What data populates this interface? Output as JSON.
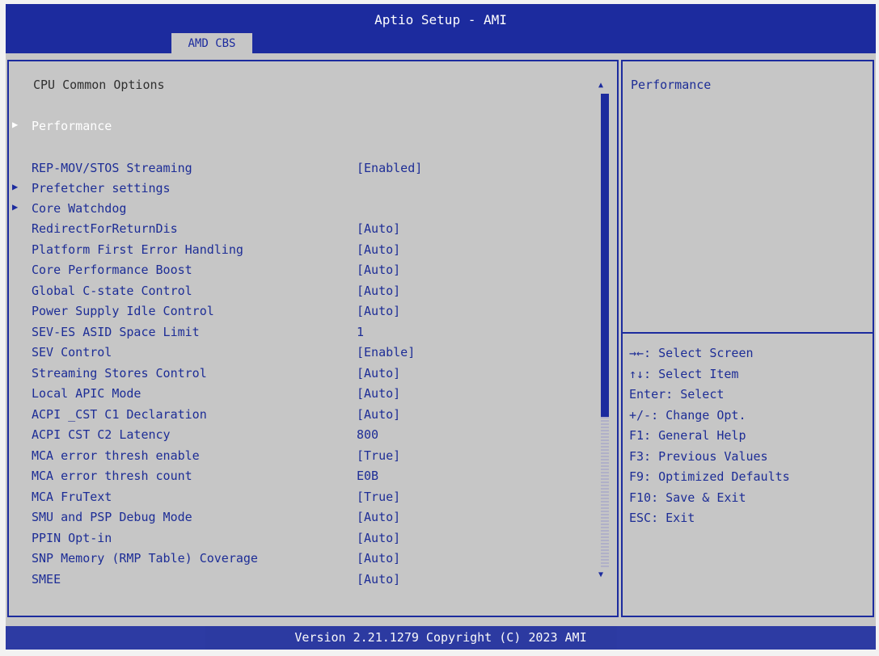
{
  "header": {
    "title": "Aptio Setup - AMI",
    "tab_label": "AMD CBS"
  },
  "main": {
    "section_title": "CPU Common Options",
    "selected_item": "Performance",
    "items": [
      {
        "label": "Performance",
        "value": "",
        "submenu": true,
        "selected": true
      },
      {
        "label": "REP-MOV/STOS Streaming",
        "value": "[Enabled]",
        "submenu": false
      },
      {
        "label": "Prefetcher settings",
        "value": "",
        "submenu": true
      },
      {
        "label": "Core Watchdog",
        "value": "",
        "submenu": true
      },
      {
        "label": "RedirectForReturnDis",
        "value": "[Auto]",
        "submenu": false
      },
      {
        "label": "Platform First Error Handling",
        "value": "[Auto]",
        "submenu": false
      },
      {
        "label": "Core Performance Boost",
        "value": "[Auto]",
        "submenu": false
      },
      {
        "label": "Global C-state Control",
        "value": "[Auto]",
        "submenu": false
      },
      {
        "label": "Power Supply Idle Control",
        "value": "[Auto]",
        "submenu": false
      },
      {
        "label": "SEV-ES ASID Space Limit",
        "value": "1",
        "submenu": false
      },
      {
        "label": "SEV Control",
        "value": "[Enable]",
        "submenu": false
      },
      {
        "label": "Streaming Stores Control",
        "value": "[Auto]",
        "submenu": false
      },
      {
        "label": "Local APIC Mode",
        "value": "[Auto]",
        "submenu": false
      },
      {
        "label": "ACPI _CST C1 Declaration",
        "value": "[Auto]",
        "submenu": false
      },
      {
        "label": "ACPI CST C2 Latency",
        "value": "800",
        "submenu": false
      },
      {
        "label": "MCA error thresh enable",
        "value": "[True]",
        "submenu": false
      },
      {
        "label": "MCA error thresh count",
        "value": "E0B",
        "submenu": false
      },
      {
        "label": "MCA FruText",
        "value": "[True]",
        "submenu": false
      },
      {
        "label": "SMU and PSP Debug Mode",
        "value": "[Auto]",
        "submenu": false
      },
      {
        "label": "PPIN Opt-in",
        "value": "[Auto]",
        "submenu": false
      },
      {
        "label": "SNP Memory (RMP Table) Coverage",
        "value": "[Auto]",
        "submenu": false
      },
      {
        "label": "SMEE",
        "value": "[Auto]",
        "submenu": false
      }
    ]
  },
  "help": {
    "title": "Performance",
    "keys": [
      "→←: Select Screen",
      "↑↓: Select Item",
      "Enter: Select",
      "+/-: Change Opt.",
      "F1: General Help",
      "F3: Previous Values",
      "F9: Optimized Defaults",
      "F10: Save & Exit",
      "ESC: Exit"
    ]
  },
  "footer": {
    "text": "Version 2.21.1279 Copyright (C) 2023 AMI"
  },
  "colors": {
    "accent": "#1c2b9e",
    "background": "#c6c6c6",
    "text": "#1d2d96",
    "highlight_text": "#ffffff"
  },
  "icons": {
    "submenu": "triangle-right-icon",
    "scroll_up": "triangle-up-icon",
    "scroll_down": "triangle-down-icon"
  }
}
